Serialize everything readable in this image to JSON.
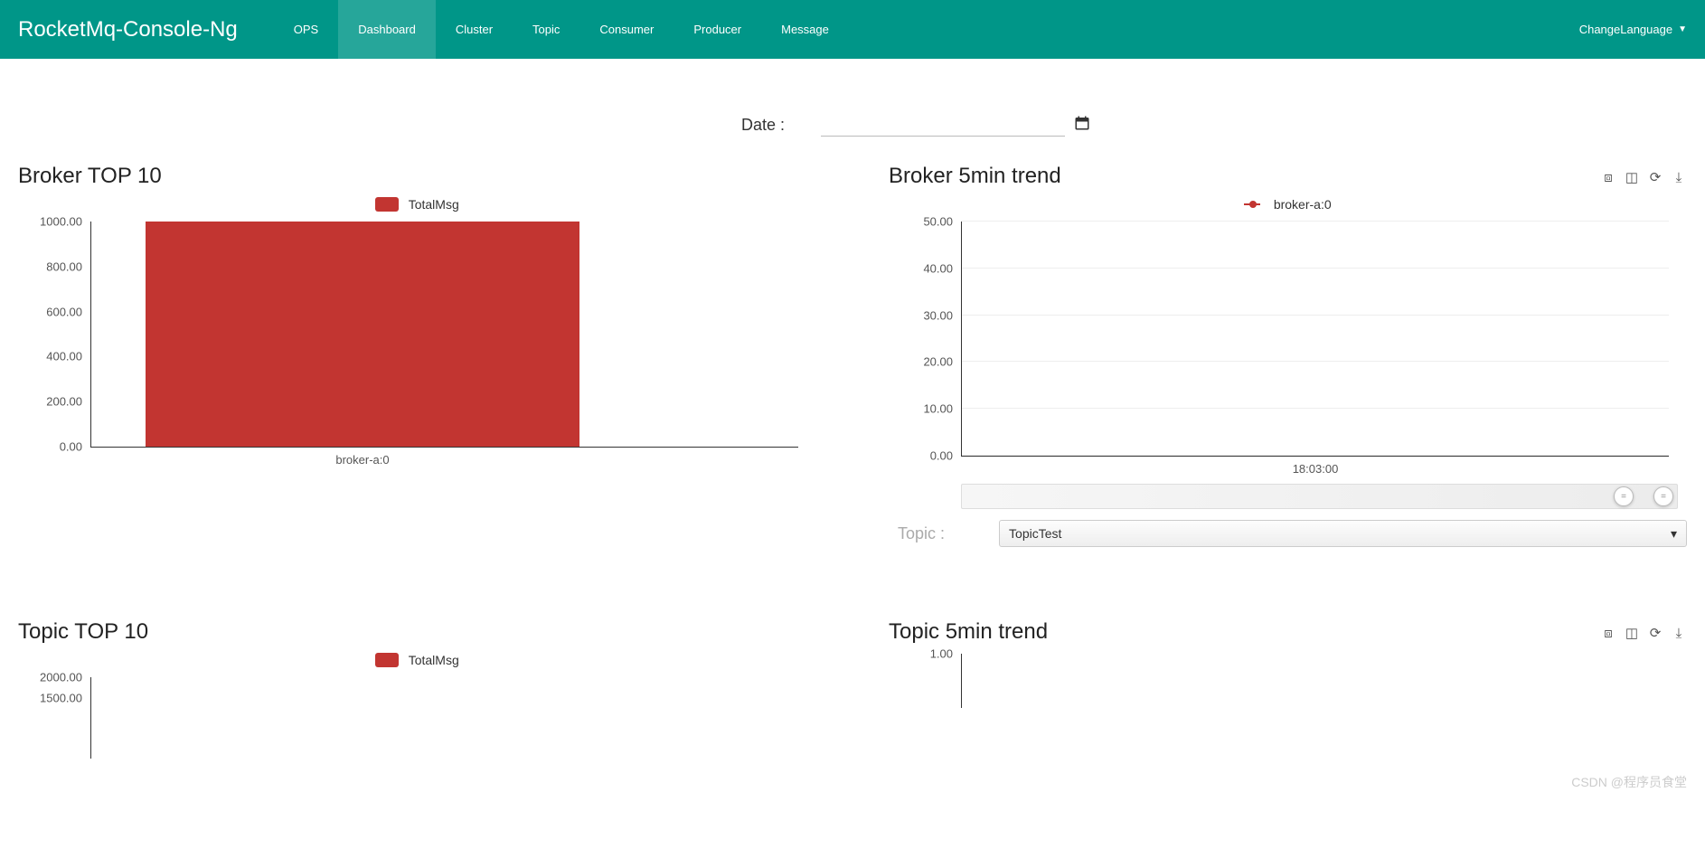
{
  "nav": {
    "brand": "RocketMq-Console-Ng",
    "items": [
      "OPS",
      "Dashboard",
      "Cluster",
      "Topic",
      "Consumer",
      "Producer",
      "Message"
    ],
    "active_index": 1,
    "lang": "ChangeLanguage"
  },
  "date": {
    "label": "Date :",
    "value": ""
  },
  "broker_top10": {
    "title": "Broker TOP 10",
    "legend": "TotalMsg"
  },
  "broker_trend": {
    "title": "Broker 5min trend",
    "legend": "broker-a:0"
  },
  "topic_top10": {
    "title": "Topic TOP 10",
    "legend": "TotalMsg"
  },
  "topic_trend": {
    "title": "Topic 5min trend",
    "topic_label": "Topic :",
    "topic_selected": "TopicTest"
  },
  "watermark": "CSDN @程序员食堂",
  "chart_data": [
    {
      "id": "broker_top10",
      "type": "bar",
      "title": "Broker TOP 10",
      "legend": [
        "TotalMsg"
      ],
      "categories": [
        "broker-a:0"
      ],
      "values": [
        1000
      ],
      "ylim": [
        0,
        1000
      ],
      "yticks": [
        0,
        200,
        400,
        600,
        800,
        1000
      ],
      "color": "#c23531"
    },
    {
      "id": "broker_trend",
      "type": "line",
      "title": "Broker 5min trend",
      "legend": [
        "broker-a:0"
      ],
      "x": [
        "18:03:00"
      ],
      "series": [
        {
          "name": "broker-a:0",
          "values": [
            0
          ]
        }
      ],
      "ylim": [
        0,
        50
      ],
      "yticks": [
        0,
        10,
        20,
        30,
        40,
        50
      ],
      "color": "#c23531"
    },
    {
      "id": "topic_top10",
      "type": "bar",
      "title": "Topic TOP 10",
      "legend": [
        "TotalMsg"
      ],
      "categories": [],
      "values": [],
      "ylim": [
        0,
        2000
      ],
      "yticks": [
        1500,
        2000
      ],
      "color": "#c23531"
    },
    {
      "id": "topic_trend",
      "type": "line",
      "title": "Topic 5min trend",
      "legend": [],
      "x": [],
      "series": [],
      "ylim": [
        0,
        1
      ],
      "yticks": [
        1
      ],
      "color": "#c23531"
    }
  ]
}
